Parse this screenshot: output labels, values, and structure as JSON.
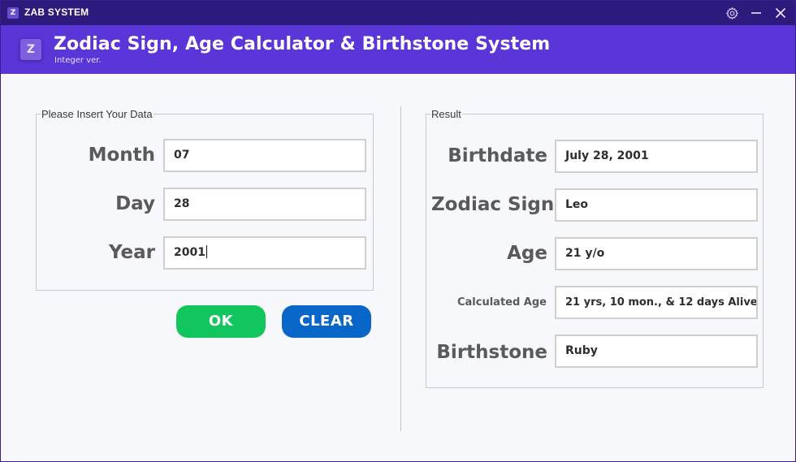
{
  "window": {
    "icon_letter": "Z",
    "title": "ZAB SYSTEM"
  },
  "header": {
    "logo_letter": "Z",
    "title": "Zodiac Sign,  Age Calculator & Birthstone System",
    "subtitle": "Integer ver."
  },
  "input_panel": {
    "legend": "Please Insert Your Data",
    "month": {
      "label": "Month",
      "value": "07"
    },
    "day": {
      "label": "Day",
      "value": "28"
    },
    "year": {
      "label": "Year",
      "value": "2001"
    }
  },
  "buttons": {
    "ok_label": "OK",
    "clear_label": "CLEAR"
  },
  "result_panel": {
    "legend": "Result",
    "birthdate": {
      "label": "Birthdate",
      "value": "July 28, 2001"
    },
    "zodiac": {
      "label": "Zodiac Sign",
      "value": "Leo"
    },
    "age": {
      "label": "Age",
      "value": "21 y/o"
    },
    "calculated_age": {
      "label": "Calculated Age",
      "value": "21 yrs, 10 mon., & 12 days Alive"
    },
    "birthstone": {
      "label": "Birthstone",
      "value": "Ruby"
    }
  },
  "colors": {
    "titlebar": "#2c1a7c",
    "header": "#5a35d8",
    "ok_button": "#12c55e",
    "clear_button": "#0966c9"
  },
  "icons": {
    "settings": "gear-icon",
    "minimize": "minimize-icon",
    "close": "close-icon"
  }
}
